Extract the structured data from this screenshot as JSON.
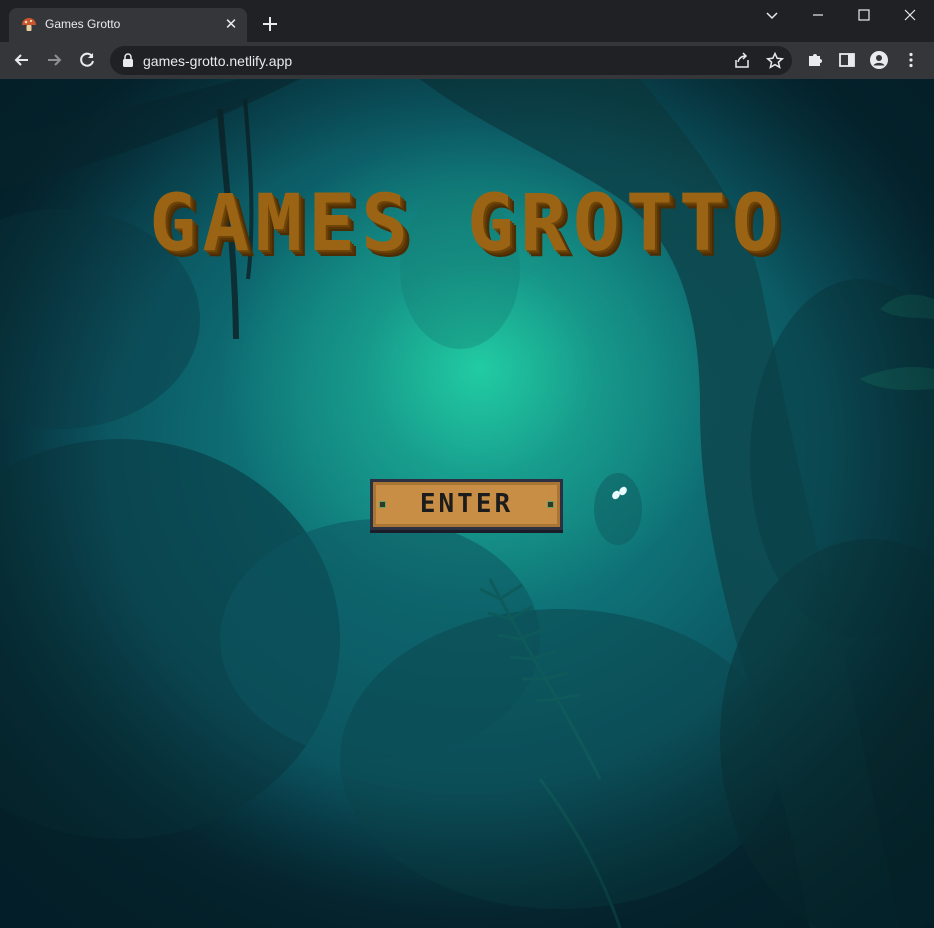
{
  "browser": {
    "tab": {
      "title": "Games Grotto",
      "close_glyph": "✕"
    },
    "address_bar": {
      "url": "games-grotto.netlify.app"
    },
    "icons": {
      "favicon": "mushroom-icon",
      "new_tab": "plus-icon",
      "tab_search": "chevron-down-icon",
      "minimize": "minimize-icon",
      "maximize": "maximize-icon",
      "close_window": "close-icon",
      "back": "arrow-left-icon",
      "forward": "arrow-right-icon",
      "reload": "reload-icon",
      "lock": "lock-icon",
      "share": "share-icon",
      "bookmark": "star-icon",
      "extensions": "puzzle-icon",
      "side_panel": "side-panel-icon",
      "profile": "profile-icon",
      "menu": "kebab-menu-icon"
    },
    "colors": {
      "frame": "#202124",
      "toolbar": "#35363a",
      "text": "#e8eaed"
    }
  },
  "page": {
    "title": "GAMES GROTTO",
    "enter_label": "ENTER",
    "colors": {
      "title": "#9a6414",
      "button": "#c98e46",
      "background_glow": "#24d8a8",
      "background_dark": "#07323f"
    }
  }
}
